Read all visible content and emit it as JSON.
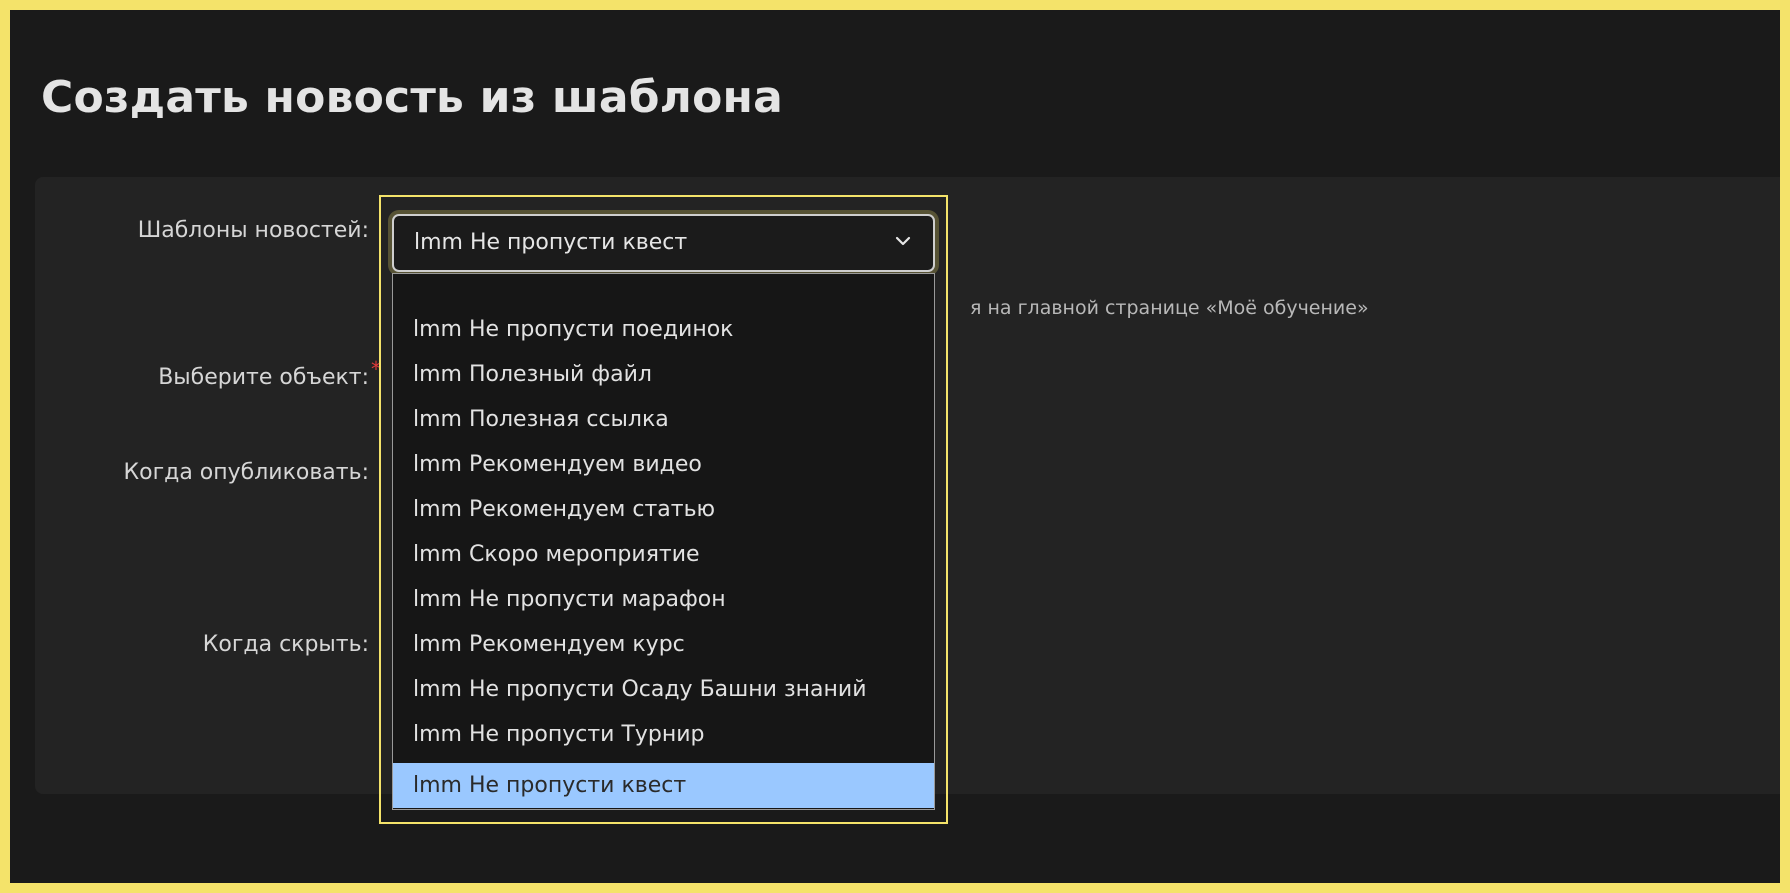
{
  "page": {
    "title": "Создать новость из шаблона"
  },
  "form": {
    "labels": {
      "templates": "Шаблоны новостей:",
      "object": "Выберите объект:",
      "publish_when": "Когда опубликовать:",
      "hide_when": "Когда скрыть:"
    },
    "required_marker": "*",
    "hint_text": "я на главной странице «Моё обучение»",
    "template_select": {
      "value": "lmm Не пропусти квест",
      "icon": "chevron-down-icon",
      "options": [
        "",
        "lmm Не пропусти поединок",
        "lmm Полезный файл",
        "lmm Полезная ссылка",
        "lmm Рекомендуем видео",
        "lmm Рекомендуем статью",
        "lmm Скоро мероприятие",
        "lmm Не пропусти марафон",
        "lmm Рекомендуем курс",
        "lmm Не пропусти Осаду Башни знаний",
        "lmm Не пропусти Турнир",
        "lmm Не пропусти квест"
      ],
      "selected_index": 11
    }
  },
  "colors": {
    "frame_border": "#f4e36a",
    "background": "#1a1a1a",
    "panel": "#232323",
    "selected_option": "#9ac8ff",
    "required": "#e03a3a"
  }
}
